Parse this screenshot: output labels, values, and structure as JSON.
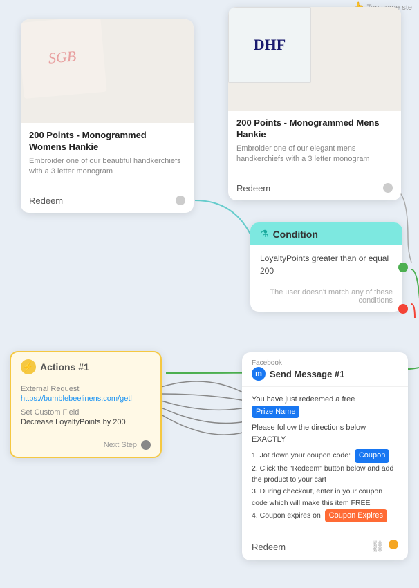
{
  "tap_hint": "Tap some ste",
  "womens_card": {
    "title": "200 Points - Monogrammed Womens Hankie",
    "description": "Embroider one of our beautiful handkerchiefs with a 3 letter monogram",
    "redeem_label": "Redeem",
    "monogram": "SGB"
  },
  "mens_card": {
    "title": "200 Points - Monogrammed Mens Hankie",
    "description": "Embroider one of our elegant mens handkerchiefs with a 3 letter monogram",
    "redeem_label": "Redeem",
    "monogram": "DHF"
  },
  "condition_card": {
    "header_title": "Condition",
    "condition_text": "LoyaltyPoints greater than or equal 200",
    "no_match_text": "The user doesn't match any of these conditions"
  },
  "actions_card": {
    "header_title": "Actions #1",
    "external_request_label": "External Request",
    "external_request_url": "https://bumblebeelinens.com/getl",
    "custom_field_label": "Set Custom Field",
    "custom_field_value": "Decrease LoyaltyPoints by 200",
    "next_step_label": "Next Step"
  },
  "fb_card": {
    "platform_label": "Facebook",
    "title": "Send Message #1",
    "message1": "You have just redeemed a free",
    "prize_highlight": "Prize Name",
    "message2": "Please follow the directions below EXACTLY",
    "step1": "1. Jot down your coupon code:",
    "coupon_highlight": "Coupon",
    "step2": "2. Click the \"Redeem\" button below and add the product to your cart",
    "step3": "3. During checkout, enter in your coupon code which will make this item FREE",
    "step4": "4. Coupon expires on",
    "coupon_expires_highlight": "Coupon Expires",
    "redeem_label": "Redeem"
  },
  "colors": {
    "condition_teal": "#7de8e0",
    "actions_yellow": "#f5c842",
    "fb_blue": "#1877f2",
    "green_dot": "#4caf50",
    "red_dot": "#f44336"
  }
}
